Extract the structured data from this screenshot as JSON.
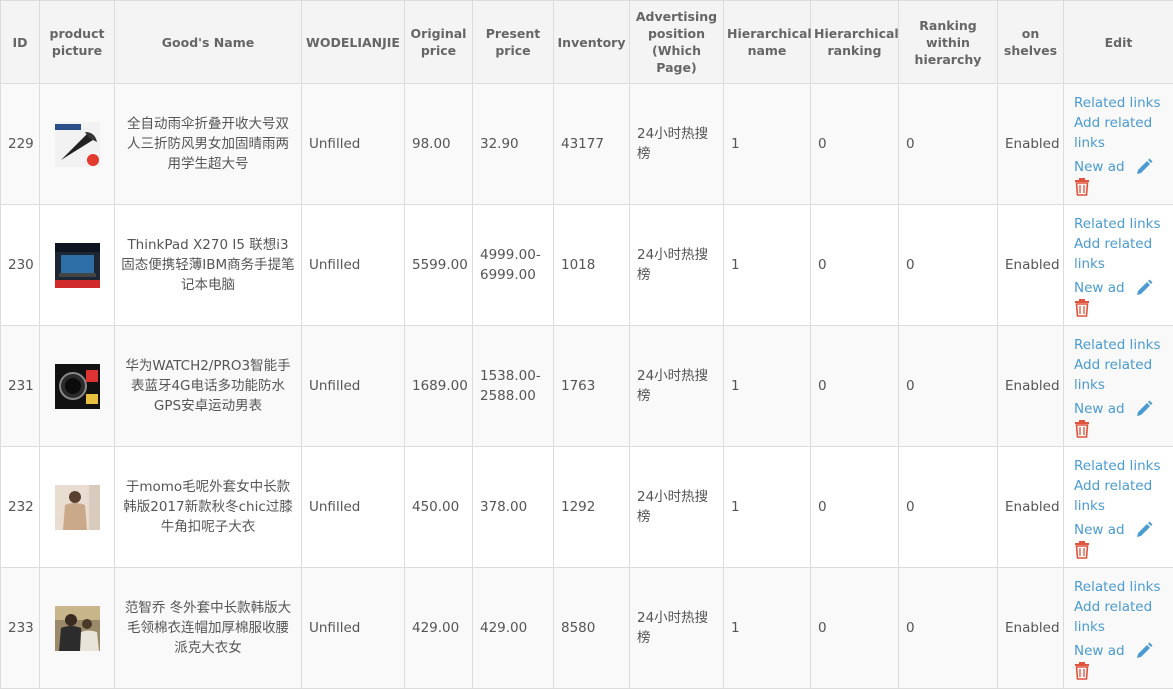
{
  "headers": {
    "id": "ID",
    "picture": "product picture",
    "name": "Good's Name",
    "wodelianjie": "WODELIANJIE",
    "original_price": "Original price",
    "present_price": "Present price",
    "inventory": "Inventory",
    "ad_position": "Advertising position (Which Page)",
    "hier_name": "Hierarchical name",
    "hier_rank": "Hierarchical ranking",
    "rank_within": "Ranking within hierarchy",
    "on_shelves": "on shelves",
    "edit": "Edit"
  },
  "actions": {
    "related_links": "Related links",
    "add_related_links": "Add related links",
    "new_ad": "New ad"
  },
  "colors": {
    "link": "#4a9bd1",
    "danger": "#e0533c",
    "header_bg": "#f4f4f4"
  },
  "rows": [
    {
      "id": "229",
      "thumb": "umbrella",
      "name": "全自动雨伞折叠开收大号双人三折防风男女加固晴雨两用学生超大号",
      "wodelianjie": "Unfilled",
      "original_price": "98.00",
      "present_price": "32.90",
      "inventory": "43177",
      "ad_position": "24小时热搜榜",
      "hier_name": "1",
      "hier_rank": "0",
      "rank_within": "0",
      "status": "Enabled"
    },
    {
      "id": "230",
      "thumb": "laptop",
      "name": "ThinkPad X270 I5 联想i3固态便携轻薄IBM商务手提笔记本电脑",
      "wodelianjie": "Unfilled",
      "original_price": "5599.00",
      "present_price": "4999.00-6999.00",
      "inventory": "1018",
      "ad_position": "24小时热搜榜",
      "hier_name": "1",
      "hier_rank": "0",
      "rank_within": "0",
      "status": "Enabled"
    },
    {
      "id": "231",
      "thumb": "watch",
      "name": "华为WATCH2/PRO3智能手表蓝牙4G电话多功能防水GPS安卓运动男表",
      "wodelianjie": "Unfilled",
      "original_price": "1689.00",
      "present_price": "1538.00-2588.00",
      "inventory": "1763",
      "ad_position": "24小时热搜榜",
      "hier_name": "1",
      "hier_rank": "0",
      "rank_within": "0",
      "status": "Enabled"
    },
    {
      "id": "232",
      "thumb": "coat",
      "name": "于momo毛呢外套女中长款韩版2017新款秋冬chic过膝牛角扣呢子大衣",
      "wodelianjie": "Unfilled",
      "original_price": "450.00",
      "present_price": "378.00",
      "inventory": "1292",
      "ad_position": "24小时热搜榜",
      "hier_name": "1",
      "hier_rank": "0",
      "rank_within": "0",
      "status": "Enabled"
    },
    {
      "id": "233",
      "thumb": "jacket",
      "name": "范智乔 冬外套中长款韩版大毛领棉衣连帽加厚棉服收腰派克大衣女",
      "wodelianjie": "Unfilled",
      "original_price": "429.00",
      "present_price": "429.00",
      "inventory": "8580",
      "ad_position": "24小时热搜榜",
      "hier_name": "1",
      "hier_rank": "0",
      "rank_within": "0",
      "status": "Enabled"
    }
  ]
}
